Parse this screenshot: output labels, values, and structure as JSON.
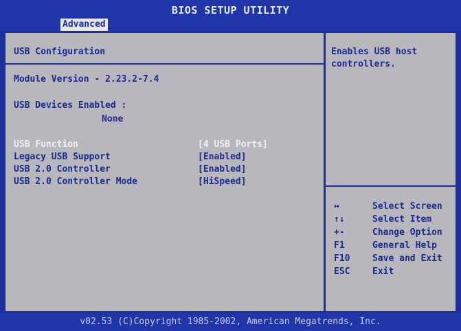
{
  "header": {
    "title": "BIOS SETUP UTILITY",
    "tab": "Advanced"
  },
  "main": {
    "section_title": "USB Configuration",
    "module_version": "Module Version - 2.23.2-7.4",
    "devices_label": "USB Devices Enabled :",
    "devices_value": "None",
    "settings": [
      {
        "label": "USB Function",
        "value": "[4 USB Ports]"
      },
      {
        "label": "Legacy USB Support",
        "value": "[Enabled]"
      },
      {
        "label": "USB 2.0 Controller",
        "value": "[Enabled]"
      },
      {
        "label": "USB 2.0 Controller Mode",
        "value": "[HiSpeed]"
      }
    ]
  },
  "help": {
    "text_line1": "Enables USB host",
    "text_line2": "controllers."
  },
  "keys": [
    {
      "key": "↔",
      "desc": "Select Screen"
    },
    {
      "key": "↑↓",
      "desc": "Select Item"
    },
    {
      "key": "+-",
      "desc": "Change Option"
    },
    {
      "key": "F1",
      "desc": "General Help"
    },
    {
      "key": "F10",
      "desc": "Save and Exit"
    },
    {
      "key": "ESC",
      "desc": "Exit"
    }
  ],
  "footer": {
    "text": "v02.53 (C)Copyright 1985-2002, American Megatrends, Inc."
  },
  "colors": {
    "background": "#b7b7bd",
    "accent": "#1c2f9a",
    "selected_text": "#eeeef6"
  }
}
